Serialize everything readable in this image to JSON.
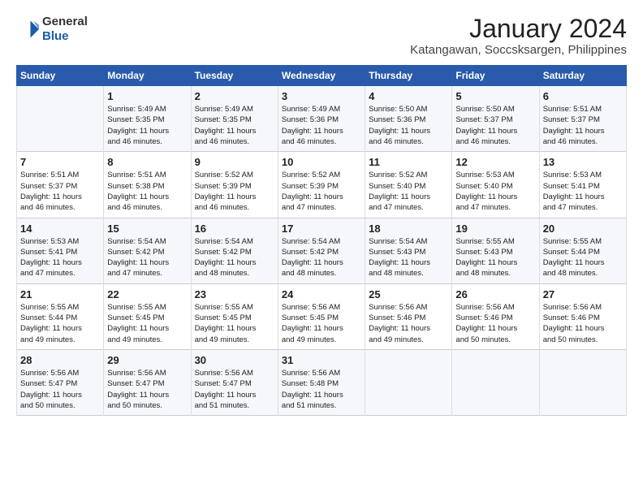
{
  "header": {
    "logo_general": "General",
    "logo_blue": "Blue",
    "title": "January 2024",
    "subtitle": "Katangawan, Soccsksargen, Philippines"
  },
  "days_of_week": [
    "Sunday",
    "Monday",
    "Tuesday",
    "Wednesday",
    "Thursday",
    "Friday",
    "Saturday"
  ],
  "weeks": [
    [
      {
        "day": "",
        "content": ""
      },
      {
        "day": "1",
        "content": "Sunrise: 5:49 AM\nSunset: 5:35 PM\nDaylight: 11 hours\nand 46 minutes."
      },
      {
        "day": "2",
        "content": "Sunrise: 5:49 AM\nSunset: 5:35 PM\nDaylight: 11 hours\nand 46 minutes."
      },
      {
        "day": "3",
        "content": "Sunrise: 5:49 AM\nSunset: 5:36 PM\nDaylight: 11 hours\nand 46 minutes."
      },
      {
        "day": "4",
        "content": "Sunrise: 5:50 AM\nSunset: 5:36 PM\nDaylight: 11 hours\nand 46 minutes."
      },
      {
        "day": "5",
        "content": "Sunrise: 5:50 AM\nSunset: 5:37 PM\nDaylight: 11 hours\nand 46 minutes."
      },
      {
        "day": "6",
        "content": "Sunrise: 5:51 AM\nSunset: 5:37 PM\nDaylight: 11 hours\nand 46 minutes."
      }
    ],
    [
      {
        "day": "7",
        "content": "Sunrise: 5:51 AM\nSunset: 5:37 PM\nDaylight: 11 hours\nand 46 minutes."
      },
      {
        "day": "8",
        "content": "Sunrise: 5:51 AM\nSunset: 5:38 PM\nDaylight: 11 hours\nand 46 minutes."
      },
      {
        "day": "9",
        "content": "Sunrise: 5:52 AM\nSunset: 5:39 PM\nDaylight: 11 hours\nand 46 minutes."
      },
      {
        "day": "10",
        "content": "Sunrise: 5:52 AM\nSunset: 5:39 PM\nDaylight: 11 hours\nand 47 minutes."
      },
      {
        "day": "11",
        "content": "Sunrise: 5:52 AM\nSunset: 5:40 PM\nDaylight: 11 hours\nand 47 minutes."
      },
      {
        "day": "12",
        "content": "Sunrise: 5:53 AM\nSunset: 5:40 PM\nDaylight: 11 hours\nand 47 minutes."
      },
      {
        "day": "13",
        "content": "Sunrise: 5:53 AM\nSunset: 5:41 PM\nDaylight: 11 hours\nand 47 minutes."
      }
    ],
    [
      {
        "day": "14",
        "content": "Sunrise: 5:53 AM\nSunset: 5:41 PM\nDaylight: 11 hours\nand 47 minutes."
      },
      {
        "day": "15",
        "content": "Sunrise: 5:54 AM\nSunset: 5:42 PM\nDaylight: 11 hours\nand 47 minutes."
      },
      {
        "day": "16",
        "content": "Sunrise: 5:54 AM\nSunset: 5:42 PM\nDaylight: 11 hours\nand 48 minutes."
      },
      {
        "day": "17",
        "content": "Sunrise: 5:54 AM\nSunset: 5:42 PM\nDaylight: 11 hours\nand 48 minutes."
      },
      {
        "day": "18",
        "content": "Sunrise: 5:54 AM\nSunset: 5:43 PM\nDaylight: 11 hours\nand 48 minutes."
      },
      {
        "day": "19",
        "content": "Sunrise: 5:55 AM\nSunset: 5:43 PM\nDaylight: 11 hours\nand 48 minutes."
      },
      {
        "day": "20",
        "content": "Sunrise: 5:55 AM\nSunset: 5:44 PM\nDaylight: 11 hours\nand 48 minutes."
      }
    ],
    [
      {
        "day": "21",
        "content": "Sunrise: 5:55 AM\nSunset: 5:44 PM\nDaylight: 11 hours\nand 49 minutes."
      },
      {
        "day": "22",
        "content": "Sunrise: 5:55 AM\nSunset: 5:45 PM\nDaylight: 11 hours\nand 49 minutes."
      },
      {
        "day": "23",
        "content": "Sunrise: 5:55 AM\nSunset: 5:45 PM\nDaylight: 11 hours\nand 49 minutes."
      },
      {
        "day": "24",
        "content": "Sunrise: 5:56 AM\nSunset: 5:45 PM\nDaylight: 11 hours\nand 49 minutes."
      },
      {
        "day": "25",
        "content": "Sunrise: 5:56 AM\nSunset: 5:46 PM\nDaylight: 11 hours\nand 49 minutes."
      },
      {
        "day": "26",
        "content": "Sunrise: 5:56 AM\nSunset: 5:46 PM\nDaylight: 11 hours\nand 50 minutes."
      },
      {
        "day": "27",
        "content": "Sunrise: 5:56 AM\nSunset: 5:46 PM\nDaylight: 11 hours\nand 50 minutes."
      }
    ],
    [
      {
        "day": "28",
        "content": "Sunrise: 5:56 AM\nSunset: 5:47 PM\nDaylight: 11 hours\nand 50 minutes."
      },
      {
        "day": "29",
        "content": "Sunrise: 5:56 AM\nSunset: 5:47 PM\nDaylight: 11 hours\nand 50 minutes."
      },
      {
        "day": "30",
        "content": "Sunrise: 5:56 AM\nSunset: 5:47 PM\nDaylight: 11 hours\nand 51 minutes."
      },
      {
        "day": "31",
        "content": "Sunrise: 5:56 AM\nSunset: 5:48 PM\nDaylight: 11 hours\nand 51 minutes."
      },
      {
        "day": "",
        "content": ""
      },
      {
        "day": "",
        "content": ""
      },
      {
        "day": "",
        "content": ""
      }
    ]
  ]
}
